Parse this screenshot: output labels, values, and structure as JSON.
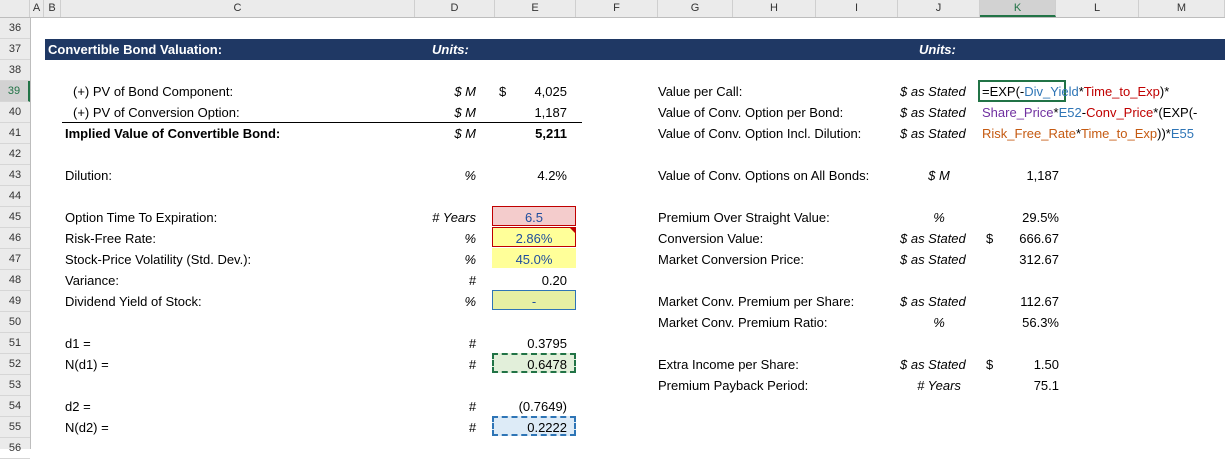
{
  "columns": [
    "A",
    "B",
    "C",
    "D",
    "E",
    "F",
    "G",
    "H",
    "I",
    "J",
    "K",
    "L",
    "M"
  ],
  "selected_column": "K",
  "rows": [
    "36",
    "37",
    "38",
    "39",
    "40",
    "41",
    "42",
    "43",
    "44",
    "45",
    "46",
    "47",
    "48",
    "49",
    "50",
    "51",
    "52",
    "53",
    "54",
    "55",
    "56"
  ],
  "selected_row": "39",
  "header": {
    "title": "Convertible Bond Valuation:",
    "units_left": "Units:",
    "units_right": "Units:"
  },
  "left_table": [
    {
      "row": "39",
      "label": "(+) PV of Bond Component:",
      "unit": "$ M",
      "currency": "$",
      "value": "4,025"
    },
    {
      "row": "40",
      "label": "(+) PV of Conversion Option:",
      "unit": "$ M",
      "currency": "",
      "value": "1,187"
    },
    {
      "row": "41",
      "label": "Implied Value of Convertible Bond:",
      "unit": "$ M",
      "currency": "",
      "value": "5,211"
    },
    {
      "row": "43",
      "label": "Dilution:",
      "unit": "%",
      "currency": "",
      "value": "4.2%"
    },
    {
      "row": "45",
      "label": "Option Time To Expiration:",
      "unit": "# Years",
      "currency": "",
      "value": "6.5"
    },
    {
      "row": "46",
      "label": "Risk-Free Rate:",
      "unit": "%",
      "currency": "",
      "value": "2.86%"
    },
    {
      "row": "47",
      "label": "Stock-Price Volatility (Std. Dev.):",
      "unit": "%",
      "currency": "",
      "value": "45.0%"
    },
    {
      "row": "48",
      "label": "Variance:",
      "unit": "#",
      "currency": "",
      "value": "0.20"
    },
    {
      "row": "49",
      "label": "Dividend Yield of Stock:",
      "unit": "%",
      "currency": "",
      "value": "-"
    },
    {
      "row": "51",
      "label": "d1 =",
      "unit": "#",
      "currency": "",
      "value": "0.3795"
    },
    {
      "row": "52",
      "label": "N(d1) =",
      "unit": "#",
      "currency": "",
      "value": "0.6478"
    },
    {
      "row": "54",
      "label": "d2 =",
      "unit": "#",
      "currency": "",
      "value": "(0.7649)"
    },
    {
      "row": "55",
      "label": "N(d2) =",
      "unit": "#",
      "currency": "",
      "value": "0.2222"
    }
  ],
  "right_table": [
    {
      "row": "39",
      "label": "Value per Call:",
      "unit": "$ as Stated",
      "currency": "",
      "value": ""
    },
    {
      "row": "40",
      "label": "Value of Conv. Option per Bond:",
      "unit": "$ as Stated",
      "currency": "",
      "value": ""
    },
    {
      "row": "41",
      "label": "Value of Conv. Option Incl. Dilution:",
      "unit": "$ as Stated",
      "currency": "",
      "value": ""
    },
    {
      "row": "43",
      "label": "Value of Conv. Options on All Bonds:",
      "unit": "$ M",
      "currency": "",
      "value": "1,187"
    },
    {
      "row": "45",
      "label": "Premium Over Straight Value:",
      "unit": "%",
      "currency": "",
      "value": "29.5%"
    },
    {
      "row": "46",
      "label": "Conversion Value:",
      "unit": "$ as Stated",
      "currency": "$",
      "value": "666.67"
    },
    {
      "row": "47",
      "label": "Market Conversion Price:",
      "unit": "$ as Stated",
      "currency": "",
      "value": "312.67"
    },
    {
      "row": "49",
      "label": "Market Conv. Premium per Share:",
      "unit": "$ as Stated",
      "currency": "",
      "value": "112.67"
    },
    {
      "row": "50",
      "label": "Market Conv. Premium Ratio:",
      "unit": "%",
      "currency": "",
      "value": "56.3%"
    },
    {
      "row": "52",
      "label": "Extra Income per Share:",
      "unit": "$ as Stated",
      "currency": "$",
      "value": "1.50"
    },
    {
      "row": "53",
      "label": "Premium Payback Period:",
      "unit": "# Years",
      "currency": "",
      "value": "75.1"
    }
  ],
  "formula": {
    "line1": [
      [
        "=EXP(-",
        ""
      ],
      [
        "Div_Yield",
        "teal"
      ],
      [
        "*",
        ""
      ],
      [
        "Time_to_Exp",
        "red"
      ],
      [
        ")*",
        ""
      ]
    ],
    "line2": [
      [
        "Share_Price",
        "pur"
      ],
      [
        "*",
        ""
      ],
      [
        "E52",
        "teal"
      ],
      [
        "-",
        ""
      ],
      [
        "Conv_Price",
        "red"
      ],
      [
        "*(EXP(-",
        ""
      ]
    ],
    "line3": [
      [
        "Risk_Free_Rate",
        "brn"
      ],
      [
        "*",
        ""
      ],
      [
        "Time_to_Exp",
        "brn"
      ],
      [
        "))*",
        ""
      ],
      [
        "E55",
        "teal"
      ]
    ]
  },
  "colors": {
    "title_band": "#1f3864",
    "input_red": "#f4cccc",
    "input_yellow": "#ffff99",
    "green_cell": "#e2efda",
    "blue_cell": "#ddebf7"
  }
}
